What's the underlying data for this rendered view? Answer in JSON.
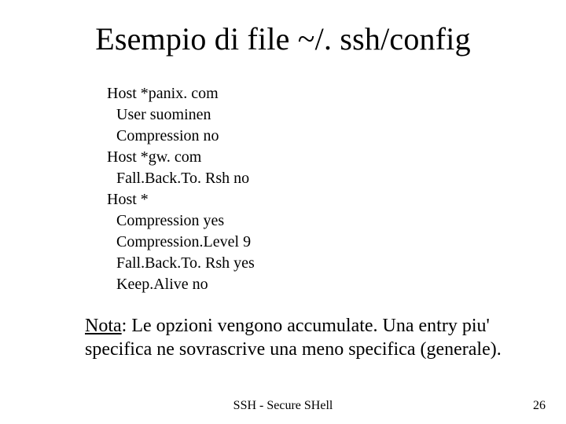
{
  "title": "Esempio di file ~/. ssh/config",
  "config": {
    "l1": "Host *panix. com",
    "l2": "User suominen",
    "l3": "Compression no",
    "l4": "Host *gw. com",
    "l5": "Fall.Back.To. Rsh no",
    "l6": "Host *",
    "l7": "Compression yes",
    "l8": "Compression.Level 9",
    "l9": "Fall.Back.To. Rsh yes",
    "l10": "Keep.Alive no"
  },
  "note": {
    "label": "Nota",
    "sep": ": ",
    "text": "Le opzioni vengono accumulate. Una entry piu' specifica ne sovrascrive una meno specifica (generale)."
  },
  "footer": {
    "center": "SSH - Secure SHell",
    "page": "26"
  }
}
